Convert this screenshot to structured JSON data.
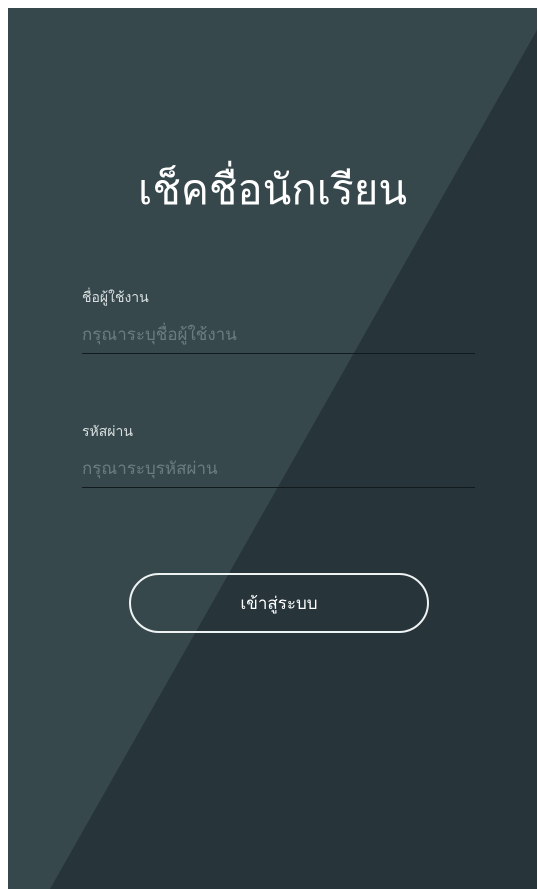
{
  "app": {
    "title": "เช็คชื่อนักเรียน"
  },
  "username": {
    "label": "ชื่อผู้ใช้งาน",
    "placeholder": "กรุณาระบุชื่อผู้ใช้งาน",
    "value": ""
  },
  "password": {
    "label": "รหัสผ่าน",
    "placeholder": "กรุณาระบุรหัสผ่าน",
    "value": ""
  },
  "login_button": {
    "label": "เข้าสู่ระบบ"
  },
  "colors": {
    "background_light": "#37484c",
    "background_dark": "#27343a",
    "text": "#ffffff",
    "input_underline": "#111a1c",
    "placeholder": "#6b7c80"
  }
}
